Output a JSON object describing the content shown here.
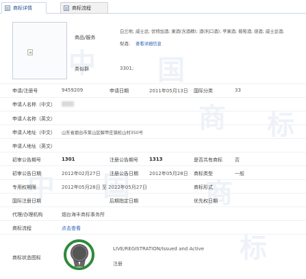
{
  "tabs": [
    {
      "label": "商标详情"
    },
    {
      "label": "商标流程"
    }
  ],
  "watermark": {
    "chars": [
      "中",
      "国",
      "商",
      "标",
      "中",
      "国",
      "商",
      "标"
    ]
  },
  "goods": {
    "label": "商品/服务",
    "line1": "白兰地; 威士忌; 伏特加酒; 果酒(含酒精); 酒(利口酒); 苹果酒; 葡萄酒; 烧酒; 威士忌酒;",
    "line2": "梨酒;",
    "detail_link": "查看详细信息"
  },
  "similar_group": {
    "label": "类似群",
    "value": "3301;"
  },
  "rows": {
    "reg_no": {
      "label": "申请/注册号",
      "value": "9459209"
    },
    "apply_date": {
      "label": "申请日期",
      "value": "2011年05月13日"
    },
    "intl_class": {
      "label": "国际分类",
      "value": "33"
    },
    "applicant_cn": {
      "label": "申请人名称（中文）",
      "value": ""
    },
    "applicant_en": {
      "label": "申请人名称（英文）",
      "value": ""
    },
    "address_cn": {
      "label": "申请人地址（中文）",
      "value": "山东省烟台市莱山区解甲庄镇松山村350号"
    },
    "address_en": {
      "label": "申请人地址（英文）",
      "value": ""
    },
    "prelim_pub_no": {
      "label": "初审公告期号",
      "value": "1301"
    },
    "reg_pub_no": {
      "label": "注册公告期号",
      "value": "1313"
    },
    "shared": {
      "label": "是否共有商标",
      "value": "否"
    },
    "prelim_pub_date": {
      "label": "初审公告日期",
      "value": "2012年02月27日"
    },
    "reg_pub_date": {
      "label": "注册公告日期",
      "value": "2012年05月28日"
    },
    "tm_type": {
      "label": "商标类型",
      "value": "一般"
    },
    "exclusive_period": {
      "label": "专用权期限",
      "value": "2012年05月28日 至 2022年05月27日"
    },
    "tm_form": {
      "label": "商标形式",
      "value": ""
    },
    "intl_reg_date": {
      "label": "国际注册日期",
      "value": ""
    },
    "later_designation": {
      "label": "后期指定日期",
      "value": ""
    },
    "priority_date": {
      "label": "优先权日期",
      "value": ""
    },
    "agency": {
      "label": "代理/办理机构",
      "value": "烟台海丰商标事务所"
    },
    "process": {
      "label": "商标流程",
      "value": "点击查看"
    },
    "status": {
      "label": "商标状态图标",
      "en": "LIVE/REGISTRATION/Issued and Active",
      "cn": "注册"
    }
  },
  "colors": {
    "accent_link": "#2a62b5",
    "badge_green": "#2e8b3a",
    "tab_border": "#c9d6e8"
  }
}
